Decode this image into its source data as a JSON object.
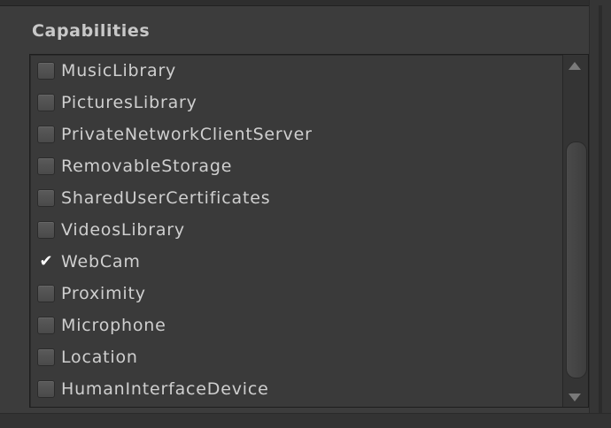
{
  "section": {
    "title": "Capabilities"
  },
  "capabilities": [
    {
      "label": "MusicLibrary",
      "checked": false
    },
    {
      "label": "PicturesLibrary",
      "checked": false
    },
    {
      "label": "PrivateNetworkClientServer",
      "checked": false
    },
    {
      "label": "RemovableStorage",
      "checked": false
    },
    {
      "label": "SharedUserCertificates",
      "checked": false
    },
    {
      "label": "VideosLibrary",
      "checked": false
    },
    {
      "label": "WebCam",
      "checked": true
    },
    {
      "label": "Proximity",
      "checked": false
    },
    {
      "label": "Microphone",
      "checked": false
    },
    {
      "label": "Location",
      "checked": false
    },
    {
      "label": "HumanInterfaceDevice",
      "checked": false
    }
  ],
  "checkmark_glyph": "✔",
  "colors": {
    "background": "#3c3c3c",
    "text": "#cfcfcf",
    "title": "#c8c8c8"
  }
}
